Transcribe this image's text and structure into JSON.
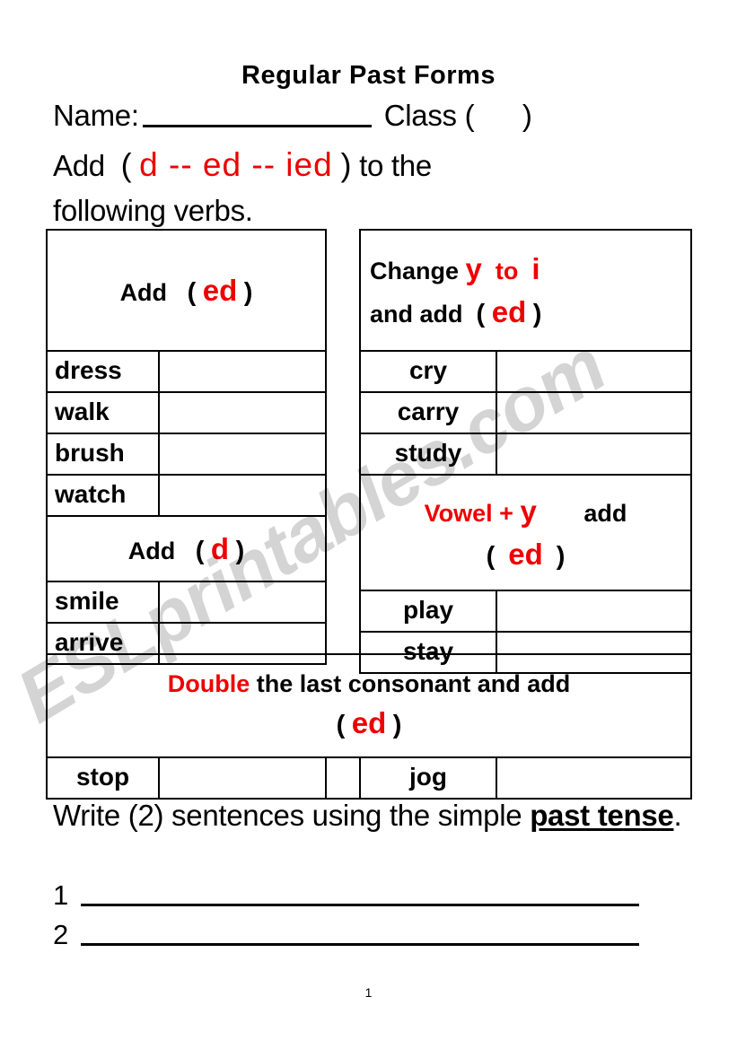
{
  "document": {
    "title": "Regular Past Forms",
    "page_number": "1",
    "watermark": "ESLprintables.com",
    "accent_red": "#ee0000",
    "text_black": "#000000"
  },
  "header": {
    "name_label": "Name:",
    "class_label": "Class",
    "class_paren_open": "(",
    "class_paren_close": ")",
    "instruction_prefix": "Add",
    "instruction_paren_open": "(",
    "instruction_endings": "d  --  ed --  ied",
    "instruction_paren_close": ")",
    "instruction_suffix": "to the",
    "instruction_line2": "following verbs."
  },
  "tables": {
    "add_ed": {
      "header_prefix": "Add",
      "header_paren_open": "(",
      "header_ending": "ed",
      "header_paren_close": ")",
      "verbs": [
        "dress",
        "walk",
        "brush",
        "watch"
      ]
    },
    "add_d": {
      "header_prefix": "Add",
      "header_paren_open": "(",
      "header_ending": "d",
      "header_paren_close": ")",
      "verbs": [
        "smile",
        "arrive"
      ]
    },
    "change_y_to_i": {
      "header_line1_prefix": "Change",
      "header_line1_y": "y",
      "header_line1_to": "to",
      "header_line1_i": "i",
      "header_line2_prefix": "and add",
      "header_line2_paren_open": "(",
      "header_line2_ending": "ed",
      "header_line2_paren_close": ")",
      "verbs": [
        "cry",
        "carry",
        "study"
      ]
    },
    "vowel_plus_y": {
      "header_line1_rule": "Vowel +",
      "header_line1_y": "y",
      "header_line1_add": "add",
      "header_line2_paren_open": "(",
      "header_line2_ending": "ed",
      "header_line2_paren_close": ")",
      "verbs": [
        "play",
        "stay"
      ]
    },
    "double_consonant": {
      "header_line1_double": "Double",
      "header_line1_rest": "the last consonant and add",
      "header_line2_paren_open": "(",
      "header_line2_ending": "ed",
      "header_line2_paren_close": ")",
      "verbs": [
        "stop",
        "jog"
      ]
    }
  },
  "footer": {
    "prompt_part1": "Write (2) sentences using the simple ",
    "prompt_emphasis": "past tense",
    "prompt_part2": ".",
    "answer_1_number": "1",
    "answer_2_number": "2"
  }
}
